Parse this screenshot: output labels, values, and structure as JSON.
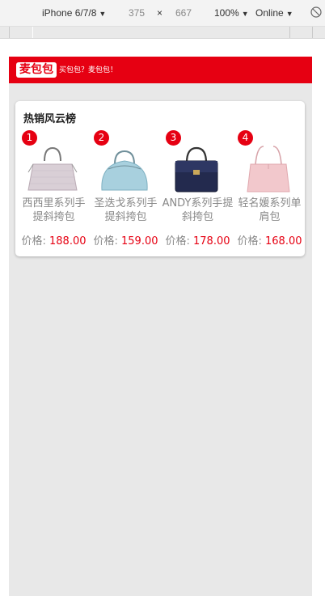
{
  "devtools": {
    "device": "iPhone 6/7/8",
    "width": "375",
    "times": "×",
    "height": "667",
    "zoom": "100%",
    "network": "Online"
  },
  "header": {
    "logo": "麦包包",
    "slogan": "买包包？麦包包！"
  },
  "hot_list": {
    "title": "热销风云榜",
    "price_label": "价格:",
    "products": [
      {
        "rank": "1",
        "name": "西西里系列手提斜挎包",
        "price": "188.00",
        "color": "#d9cfd6"
      },
      {
        "rank": "2",
        "name": "圣迭戈系列手提斜挎包",
        "price": "159.00",
        "color": "#a8d0de"
      },
      {
        "rank": "3",
        "name": "ANDY系列手提斜挎包",
        "price": "178.00",
        "color": "#232a4e"
      },
      {
        "rank": "4",
        "name": "轻名媛系列单肩包",
        "price": "168.00",
        "color": "#f2c8cc"
      }
    ]
  },
  "colors": {
    "brand_red": "#e60012",
    "page_bg": "#e8e8e8"
  }
}
